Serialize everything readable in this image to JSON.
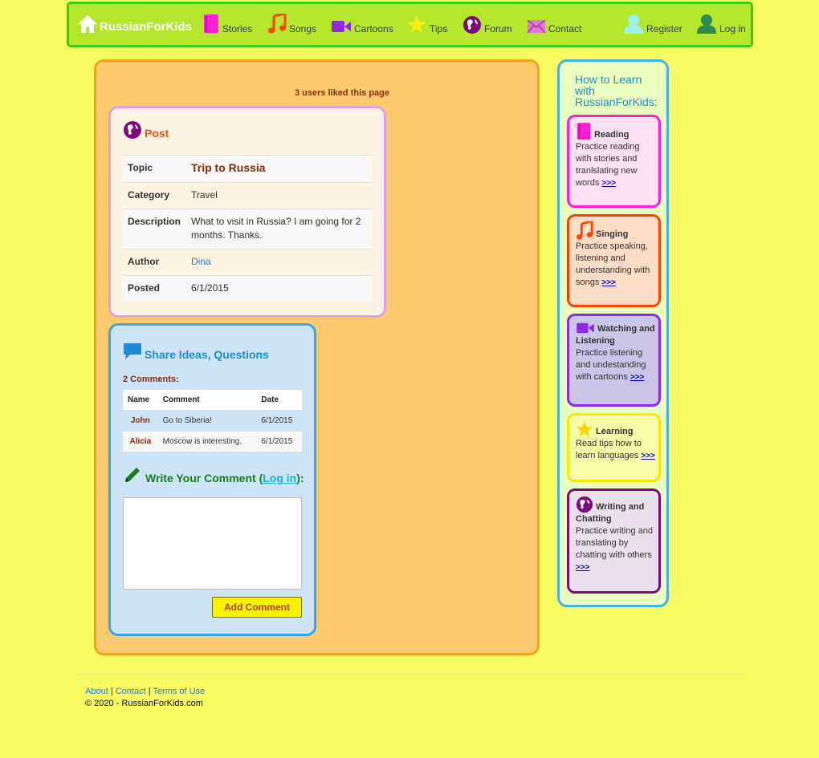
{
  "nav": {
    "brand": "RussianForKids",
    "items": [
      {
        "label": "Stories",
        "icon": "book-icon"
      },
      {
        "label": "Songs",
        "icon": "music-note-icon"
      },
      {
        "label": "Cartoons",
        "icon": "video-camera-icon"
      },
      {
        "label": "Tips",
        "icon": "star-icon"
      },
      {
        "label": "Forum",
        "icon": "globe-icon"
      },
      {
        "label": "Contact",
        "icon": "envelope-icon"
      },
      {
        "label": "Register",
        "icon": "user-icon"
      },
      {
        "label": "Log in",
        "icon": "user-icon"
      }
    ]
  },
  "likes": "3 users liked this page",
  "post": {
    "title": "Post",
    "rows": [
      {
        "label": "Topic",
        "value": "Trip to Russia"
      },
      {
        "label": "Category",
        "value": "Travel"
      },
      {
        "label": "Description",
        "value": "What to visit in Russia? I am going for 2 months. Thanks."
      },
      {
        "label": "Author",
        "value": "Dina"
      },
      {
        "label": "Posted",
        "value": "6/1/2015"
      }
    ]
  },
  "comments": {
    "title": "Share Ideas, Questions",
    "count": "2 Comments:",
    "headers": [
      "Name",
      "Comment",
      "Date"
    ],
    "rows": [
      {
        "name": "John",
        "comment": "Go to Siberia!",
        "date": "6/1/2015"
      },
      {
        "name": "Alicia",
        "comment": "Moscow is interesting.",
        "date": "6/1/2015"
      }
    ],
    "write_prefix": "Write Your Comment (",
    "login_link": "Log in",
    "write_suffix": "):",
    "add_button": "Add Comment"
  },
  "sidebar": {
    "title": "How to Learn with RussianForKids:",
    "boxes": [
      {
        "heading": "Reading",
        "text": "Practice reading with stories and tranlslating new words",
        "more": ">>>",
        "icon": "book-icon",
        "color": "#ff1dd9"
      },
      {
        "heading": "Singing",
        "text": "Practice speaking, listening and understanding with songs",
        "more": ">>>",
        "icon": "music-note-icon",
        "color": "#ff4200"
      },
      {
        "heading": "Watching and Listening",
        "text": "Practice listening and undestanding with cartoons",
        "more": ">>>",
        "icon": "video-camera-icon",
        "color": "#8c2ae5"
      },
      {
        "heading": "Learning",
        "text": "Read tips how to learn languages",
        "more": ">>>",
        "icon": "star-icon",
        "color": "#f7e600"
      },
      {
        "heading": "Writing and Chatting",
        "text": "Practice writing and translating by chatting with others",
        "more": ">>>",
        "icon": "globe-icon",
        "color": "#7e0a79"
      }
    ]
  },
  "footer": {
    "links": [
      "About",
      "Contact",
      "Terms of Use"
    ],
    "sep": "|",
    "copyright": "© 2020 - RussianForKids.com"
  }
}
